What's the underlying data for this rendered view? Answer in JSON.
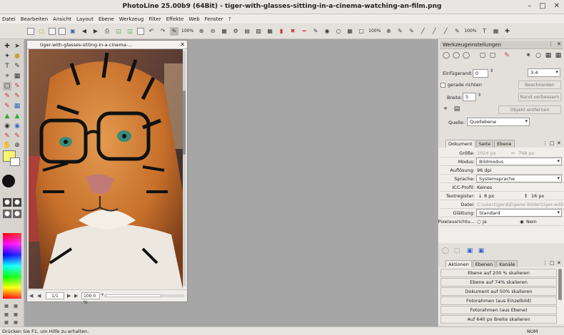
{
  "app": {
    "title": "PhotoLine 25.00b9 (64Bit) - tiger-with-glasses-sitting-in-a-cinema-watching-an-film.png"
  },
  "menu": [
    "Datei",
    "Bearbeiten",
    "Ansicht",
    "Layout",
    "Ebene",
    "Werkzeug",
    "Filter",
    "Effekte",
    "Web",
    "Fenster",
    "?"
  ],
  "toolbar": {
    "zoom1": "100%",
    "zoom2": "100%",
    "zoom3": "100%"
  },
  "document": {
    "tab_title": "tiger-with-glasses-sitting-in-a-cinema-...",
    "page": "1/1",
    "zoom": "100.0 %"
  },
  "tool_settings": {
    "title": "Werkzeugeinstellungen",
    "margin_label": "Einfügerand:",
    "margin_value": "0",
    "ratio_value": "3:4",
    "straighten_label": "gerade richten",
    "crop_button": "Beschneiden",
    "width_label": "Breite:",
    "width_value": "5",
    "improve_edge_button": "Rand verbessern",
    "remove_object_button": "Objekt entfernen",
    "source_label": "Quelle:",
    "source_value": "Quellebene"
  },
  "doc_tabs": [
    "Dokument",
    "Seite",
    "Ebene"
  ],
  "properties": [
    {
      "key": "Größe:",
      "value": "1024 px",
      "value2": "768 px",
      "type": "size"
    },
    {
      "key": "Modus:",
      "value": "Bildmodus",
      "type": "select"
    },
    {
      "key": "Auflösung:",
      "value": "96 dpi",
      "type": "text"
    },
    {
      "key": "Sprache:",
      "value": "Systemsprache",
      "type": "select"
    },
    {
      "key": "ICC-Profil:",
      "value": "Keines",
      "type": "text"
    },
    {
      "key": "Textregister:",
      "value": "8 px",
      "value2": "16 px",
      "type": "reg"
    },
    {
      "key": "Datei:",
      "value": "C:\\users\\gerd\\Eigene Bilder\\tiger-with-g",
      "type": "path"
    },
    {
      "key": "Glättung:",
      "value": "Standard",
      "type": "select"
    },
    {
      "key": "Pixelausrichtu...",
      "value": "Ja",
      "value2": "Nein",
      "type": "radio"
    }
  ],
  "action_tabs": [
    "Aktionen",
    "Ebenen",
    "Kanäle"
  ],
  "actions": [
    "Ebene auf 200 % skalieren",
    "Ebene auf 74% skalieren",
    "Dokument auf 50% skalieren",
    "Fotorahmen (aus Einzelbild)",
    "Fotorahmen (aus Ebene)",
    "Auf 640 px Breite skalieren"
  ],
  "status": {
    "hint": "Drücken Sie F1, um Hilfe zu erhalten.",
    "num": "NUM"
  },
  "colors": {
    "foreground": "#f7f56e",
    "background": "#ffffff"
  }
}
